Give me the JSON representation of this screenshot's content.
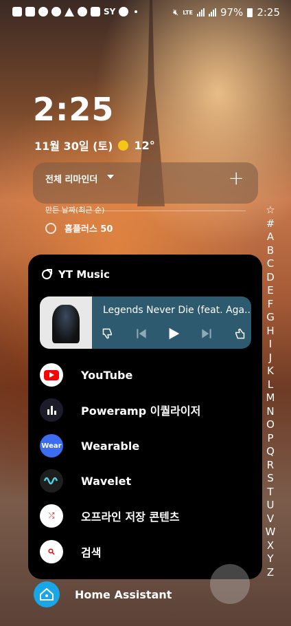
{
  "status_bar": {
    "left_text": "SY",
    "network": "LTE",
    "battery": "97%",
    "time": "2:25"
  },
  "lock_widget": {
    "time": "2:25",
    "date": "11월 30일 (토)",
    "temperature": "12°"
  },
  "reminder": {
    "title": "전체 리마인더",
    "section": "만든 날짜(최근 순)",
    "item": "홈플러스 50"
  },
  "alphabet_index": [
    "☆",
    "#",
    "A",
    "B",
    "C",
    "D",
    "E",
    "F",
    "G",
    "H",
    "I",
    "J",
    "K",
    "L",
    "M",
    "N",
    "O",
    "P",
    "Q",
    "R",
    "S",
    "T",
    "U",
    "V",
    "W",
    "X",
    "Y",
    "Z"
  ],
  "popup": {
    "header": "YT Music",
    "player": {
      "song": "Legends Never Die (feat. Aga..."
    },
    "apps": [
      {
        "label": "YouTube",
        "icon": "youtube-icon",
        "color": "#ff0000"
      },
      {
        "label": "Poweramp 이퀄라이저",
        "icon": "poweramp-eq-icon",
        "color": "#1b1b2a"
      },
      {
        "label": "Wearable",
        "icon": "wearable-icon",
        "color": "#3c6df0"
      },
      {
        "label": "Wavelet",
        "icon": "wavelet-icon",
        "color": "#1e1e1e"
      },
      {
        "label": "오프라인 저장 콘텐츠",
        "icon": "offline-shuffle-icon",
        "color": "#ffffff"
      },
      {
        "label": "검색",
        "icon": "search-icon",
        "color": "#ffffff"
      }
    ]
  },
  "bottom_app": {
    "label": "Home Assistant",
    "icon": "home-assistant-icon",
    "color": "#18a6e6"
  }
}
